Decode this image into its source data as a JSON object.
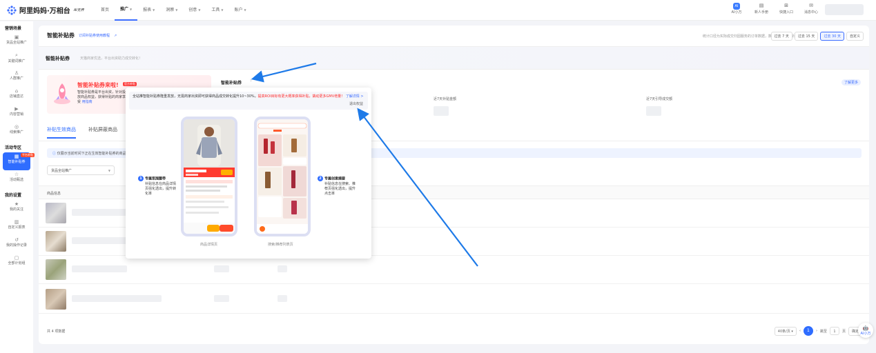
{
  "app": {
    "name": "阿里妈妈·万相台",
    "badge": "AI无界"
  },
  "nav": {
    "items": [
      {
        "label": "首页",
        "dropdown": false,
        "active": false
      },
      {
        "label": "推广",
        "dropdown": true,
        "active": true
      },
      {
        "label": "报表",
        "dropdown": true,
        "active": false
      },
      {
        "label": "洞察",
        "dropdown": true,
        "active": false
      },
      {
        "label": "创意",
        "dropdown": true,
        "active": false
      },
      {
        "label": "工具",
        "dropdown": true,
        "active": false
      },
      {
        "label": "账户",
        "dropdown": true,
        "active": false
      }
    ]
  },
  "tools": [
    {
      "label": "AI小万",
      "icon": "ai-assistant-icon"
    },
    {
      "label": "新人手册",
      "icon": "book-icon"
    },
    {
      "label": "快捷入口",
      "icon": "grid-icon"
    },
    {
      "label": "消息中心",
      "icon": "message-icon"
    }
  ],
  "sidebar": {
    "groups": [
      {
        "title": "营销场景",
        "items": [
          {
            "label": "货品全站推广",
            "icon": "goods-icon"
          },
          {
            "label": "关键词推广",
            "icon": "keyword-icon"
          },
          {
            "label": "人群推广",
            "icon": "people-icon"
          },
          {
            "label": "店铺直达",
            "icon": "store-icon"
          },
          {
            "label": "内容营销",
            "icon": "content-icon"
          },
          {
            "label": "线索推广",
            "icon": "lead-icon"
          }
        ]
      },
      {
        "title": "活动专区",
        "items": [
          {
            "label": "智能补贴券",
            "icon": "coupon-icon",
            "active": true
          },
          {
            "label": "活动甄选",
            "icon": "activity-icon"
          }
        ]
      },
      {
        "title": "我的设置",
        "items": [
          {
            "label": "我的关注",
            "icon": "star-icon"
          },
          {
            "label": "自定义报表",
            "icon": "report-icon"
          },
          {
            "label": "我的操作记录",
            "icon": "history-icon"
          },
          {
            "label": "全部计划组",
            "icon": "folder-icon"
          }
        ]
      }
    ],
    "badge": "平台补贴"
  },
  "page": {
    "title": "智能补贴券",
    "link": "订阅补贴券使用教程",
    "range_note": "统计口径为实际成交归因服务的订单数据，数据每日9点更新",
    "ranges": [
      "过去 7 天",
      "过去 15 天",
      "过去 30 天",
      "自定义"
    ],
    "range_active": 2
  },
  "intro": {
    "title": "智能补贴券",
    "subtitle": "天猫商家优选，平台出资助力成交转化！"
  },
  "promo": {
    "title": "智能补贴券来啦!",
    "tag": "官方补贴",
    "desc": "智能补贴券是平台出资，针对投放商品权益，获得补贴的商家享受",
    "link": "用指南"
  },
  "kpi": {
    "title": "智能补贴券",
    "help": "?",
    "badge": "了解更多",
    "labels": [
      "近7天补贴金额",
      "近7天引导成交额"
    ]
  },
  "tabs": [
    "补贴生效商品",
    "补贴屏蔽商品"
  ],
  "notice": "仅展示当前时间下正在生效智能补贴券的商品",
  "filter": {
    "select": "货品全站推广"
  },
  "table": {
    "header": "商品信息",
    "rows": 4
  },
  "footer": {
    "count": "共 4 项数据"
  },
  "pager": {
    "size": "40条/页",
    "current": "1",
    "goto_label": "跳至",
    "goto_value": "1",
    "page_unit": "页",
    "confirm": "确定"
  },
  "popup": {
    "banner_plain": "全站推智能补贴券隆重发放，无需商家出资即可获得商品成交转化提升10~30%，",
    "banner_red": "提高ROI目标有更大概率获得补贴，撬动更多GMV增量！",
    "banner_link": "了解详情 >",
    "close": "退出权益",
    "callout1_title": "专属氛围腰带",
    "callout1_text": "补贴信息在商品详情页强化透出，提升转化率",
    "callout2_title": "专属创意摘要",
    "callout2_text": "补贴信息在搜索、推荐页强化透出，提升点击率",
    "caption1": "商品详情页",
    "caption2": "搜索/推荐列表页",
    "phone1_price": "¥168",
    "phone2_tab": "推荐"
  },
  "float_ai": "AI小万",
  "colors": {
    "accent": "#2f6dff",
    "promo_red": "#ff3d3d",
    "annotation_arrow": "#1e7ae8"
  }
}
